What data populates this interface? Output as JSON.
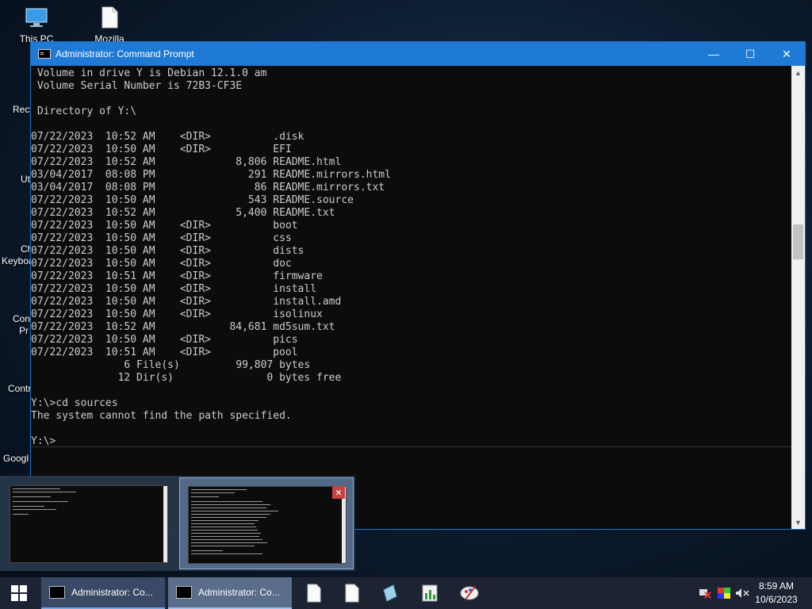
{
  "desktop": {
    "icons": [
      {
        "label": "This PC",
        "icon": "this-pc-icon"
      },
      {
        "label": "Mozilla Firefox",
        "icon": "document-icon"
      }
    ],
    "left_labels": [
      "Recy",
      "Uti",
      "Ch",
      "Keyboa",
      "Con",
      "Pr",
      "Contr",
      "Googl"
    ]
  },
  "window": {
    "title": "Administrator: Command Prompt",
    "minimize": "—",
    "maximize": "☐",
    "close": "✕",
    "console_lines": [
      " Volume in drive Y is Debian 12.1.0 am",
      " Volume Serial Number is 72B3-CF3E",
      "",
      " Directory of Y:\\",
      "",
      "07/22/2023  10:52 AM    <DIR>          .disk",
      "07/22/2023  10:50 AM    <DIR>          EFI",
      "07/22/2023  10:52 AM             8,806 README.html",
      "03/04/2017  08:08 PM               291 README.mirrors.html",
      "03/04/2017  08:08 PM                86 README.mirrors.txt",
      "07/22/2023  10:50 AM               543 README.source",
      "07/22/2023  10:52 AM             5,400 README.txt",
      "07/22/2023  10:50 AM    <DIR>          boot",
      "07/22/2023  10:50 AM    <DIR>          css",
      "07/22/2023  10:50 AM    <DIR>          dists",
      "07/22/2023  10:50 AM    <DIR>          doc",
      "07/22/2023  10:51 AM    <DIR>          firmware",
      "07/22/2023  10:50 AM    <DIR>          install",
      "07/22/2023  10:50 AM    <DIR>          install.amd",
      "07/22/2023  10:50 AM    <DIR>          isolinux",
      "07/22/2023  10:52 AM            84,681 md5sum.txt",
      "07/22/2023  10:50 AM    <DIR>          pics",
      "07/22/2023  10:51 AM    <DIR>          pool",
      "               6 File(s)         99,807 bytes",
      "              12 Dir(s)               0 bytes free",
      "",
      "Y:\\>cd sources",
      "The system cannot find the path specified.",
      "",
      "Y:\\>"
    ]
  },
  "previews": {
    "close": "✕"
  },
  "taskbar": {
    "start_icon": "windows-logo-icon",
    "tasks": [
      {
        "label": "Administrator: Co...",
        "state": "active"
      },
      {
        "label": "Administrator: Co...",
        "state": "hover"
      }
    ],
    "pinned": [
      "document-icon",
      "document-icon",
      "notepad-icon",
      "spreadsheet-icon",
      "paint-icon"
    ],
    "tray": [
      "network-icon",
      "color-icon",
      "volume-muted-icon"
    ],
    "time": "8:59 AM",
    "date": "10/6/2023"
  }
}
